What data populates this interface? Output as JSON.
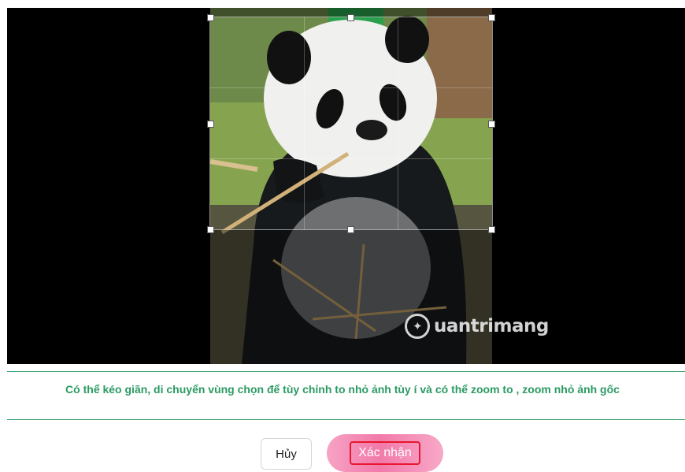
{
  "editor": {
    "image_label": "panda-eating-bamboo",
    "watermark": "uantrimang"
  },
  "hint": {
    "text": "Có thể kéo giãn, di chuyển vùng chọn để tùy chỉnh to nhỏ ảnh tùy í và có thể zoom to , zoom nhỏ ảnh gốc"
  },
  "actions": {
    "cancel_label": "Hủy",
    "confirm_label": "Xác nhận"
  },
  "colors": {
    "accent": "#2a9a62",
    "confirm_pink": "#f27aa9",
    "highlight_red": "#e8162e"
  }
}
